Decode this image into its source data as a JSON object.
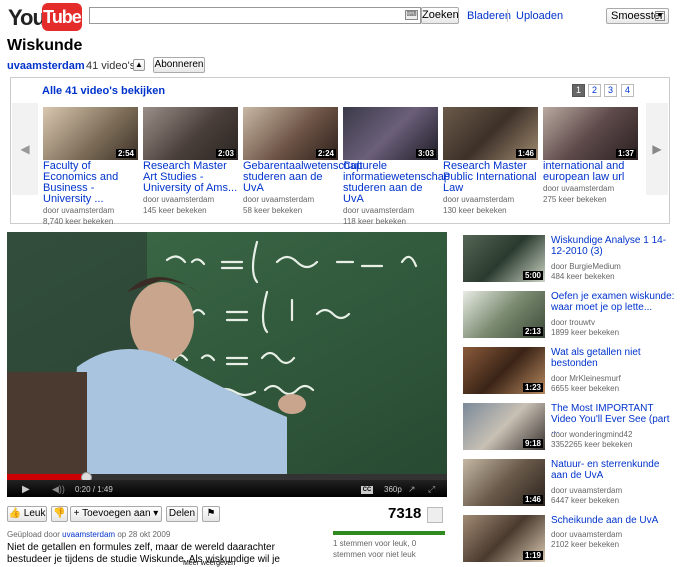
{
  "header": {
    "logo_you": "You",
    "logo_tube": "Tube",
    "search_placeholder": "",
    "search_button": "Zoeken",
    "browse_link": "Bladeren",
    "upload_link": "Uploaden",
    "user_menu": "Smoesster"
  },
  "channel": {
    "page_title": "Wiskunde",
    "channel_name": "uvaamsterdam",
    "video_count": "41 video's",
    "subscribe_button": "Abonneren"
  },
  "playlist": {
    "title": "Alle 41 video's bekijken",
    "pages": [
      "1",
      "2",
      "3",
      "4"
    ],
    "active_page": "1",
    "videos": [
      {
        "title": "Faculty of Economics and Business - University ...",
        "by": "door uvaamsterdam",
        "views": "8,740 keer bekeken",
        "duration": "2:54"
      },
      {
        "title": "Research Master Art Studies - University of Ams...",
        "by": "door uvaamsterdam",
        "views": "145 keer bekeken",
        "duration": "2:03"
      },
      {
        "title": "Gebarentaalwetenschap studeren aan de UvA",
        "by": "door uvaamsterdam",
        "views": "58 keer bekeken",
        "duration": "2:24"
      },
      {
        "title": "Culturele informatiewetenschap studeren aan de UvA",
        "by": "door uvaamsterdam",
        "views": "118 keer bekeken",
        "duration": "3:03"
      },
      {
        "title": "Research Master Public International Law",
        "by": "door uvaamsterdam",
        "views": "130 keer bekeken",
        "duration": "1:46"
      },
      {
        "title": "international and european law url",
        "by": "door uvaamsterdam",
        "views": "275 keer bekeken",
        "duration": "1:37"
      }
    ]
  },
  "player": {
    "time": "0:20 / 1:49",
    "progress_fraction": 0.18,
    "quality": "360p",
    "cc": "CC"
  },
  "actions": {
    "like": "Leuk",
    "add_to": "Toevoegen aan",
    "share": "Delen",
    "views": "7318"
  },
  "info": {
    "uploaded_prefix": "Geüpload door",
    "uploader": "uvaamsterdam",
    "upload_date": "op 28 okt 2009",
    "description": "Niet de getallen en formules zelf, maar de wereld daarachter bestudeer je tijdens de studie Wiskunde. Als wiskundige wil je bijvoorbeeld begrijpen",
    "like_stats": "1 stemmen voor leuk, 0 stemmen voor niet leuk",
    "more": "Meer weergeven"
  },
  "related": [
    {
      "title": "Wiskundige Analyse 1 14-12-2010 (3)",
      "by": "door BurgieMedium",
      "views": "484 keer bekeken",
      "duration": "5:00"
    },
    {
      "title": "Oefen je examen wiskunde: waar moet je op lette...",
      "by": "door trouwtv",
      "views": "1899 keer bekeken",
      "duration": "2:13"
    },
    {
      "title": "Wat als getallen niet bestonden",
      "by": "door MrKleinesmurf",
      "views": "6655 keer bekeken",
      "duration": "1:23"
    },
    {
      "title": "The Most IMPORTANT Video You'll Ever See (part ...",
      "by": "door wonderingmind42",
      "views": "3352265 keer bekeken",
      "duration": "9:18"
    },
    {
      "title": "Natuur- en sterrenkunde aan de UvA",
      "by": "door uvaamsterdam",
      "views": "6447 keer bekeken",
      "duration": "1:46"
    },
    {
      "title": "Scheikunde aan de UvA",
      "by": "door uvaamsterdam",
      "views": "2102 keer bekeken",
      "duration": "1:19"
    }
  ],
  "colors": {
    "brand_red": "#e42d2b",
    "link_blue": "#0033cc",
    "progress_red": "#cc0000",
    "like_green": "#2f8a1f"
  }
}
